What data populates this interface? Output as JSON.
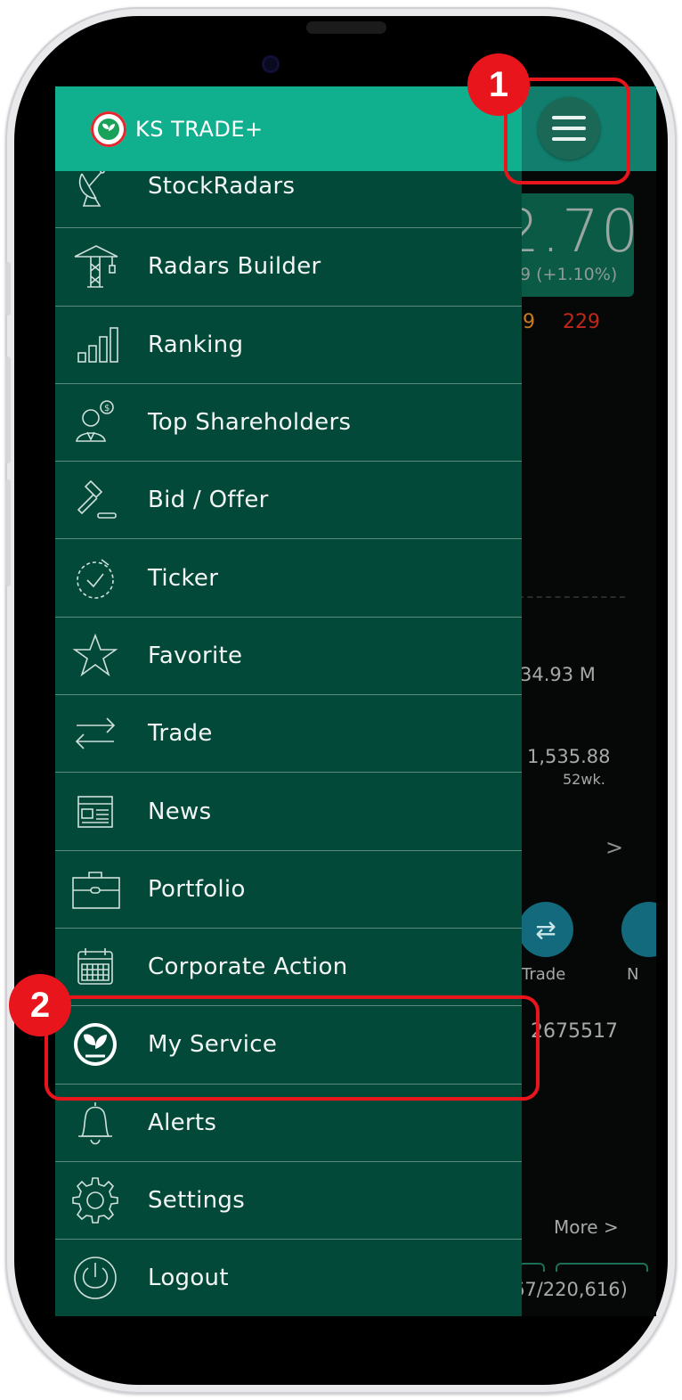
{
  "app": {
    "brand": "KS TRADE+"
  },
  "menu": {
    "items": [
      {
        "label": "StockRadars",
        "icon": "radar-dish-icon"
      },
      {
        "label": "Radars Builder",
        "icon": "crane-icon"
      },
      {
        "label": "Ranking",
        "icon": "bar-chart-icon"
      },
      {
        "label": "Top Shareholders",
        "icon": "shareholder-icon"
      },
      {
        "label": "Bid / Offer",
        "icon": "gavel-icon"
      },
      {
        "label": "Ticker",
        "icon": "timer-icon"
      },
      {
        "label": "Favorite",
        "icon": "star-icon"
      },
      {
        "label": "Trade",
        "icon": "trade-arrows-icon"
      },
      {
        "label": "News",
        "icon": "newspaper-icon"
      },
      {
        "label": "Portfolio",
        "icon": "briefcase-icon"
      },
      {
        "label": "Corporate Action",
        "icon": "calendar-icon"
      },
      {
        "label": "My Service",
        "icon": "kbank-logo-icon"
      },
      {
        "label": "Alerts",
        "icon": "bell-icon"
      },
      {
        "label": "Settings",
        "icon": "gear-icon"
      },
      {
        "label": "Logout",
        "icon": "power-icon"
      }
    ]
  },
  "background": {
    "price": "2.70",
    "change": "9 (+1.10%)",
    "value_a": "9",
    "value_b": "229",
    "turnover": "34.93 M",
    "high_52wk": "1,535.88",
    "wk_label": "52wk.",
    "chevron": ">",
    "trade_label": "Trade",
    "n_label": "N",
    "account": "2675517",
    "more": "More >",
    "volume": "67/220,616)"
  },
  "annotations": {
    "step1": "1",
    "step2": "2",
    "color": "#e8161c"
  },
  "colors": {
    "drawer": "#034939",
    "header": "#10b08f",
    "accent_red": "#e8161c"
  }
}
